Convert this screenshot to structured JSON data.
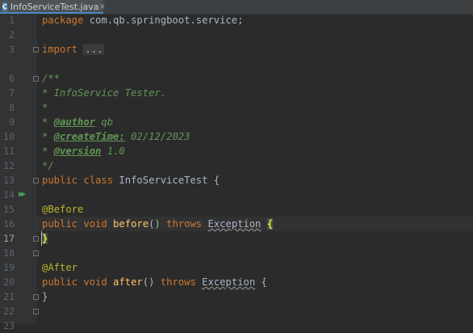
{
  "tab": {
    "title": "InfoServiceTest.java",
    "file_icon": "java-class-icon",
    "close_icon": "×"
  },
  "lines": {
    "n1": "1",
    "n2": "2",
    "n3": "3",
    "n6": "6",
    "n7": "7",
    "n8": "8",
    "n9": "9",
    "n10": "10",
    "n11": "11",
    "n12": "12",
    "n13": "13",
    "n14": "14",
    "n15": "15",
    "n16": "16",
    "n17": "17",
    "n18": "18",
    "n19": "19",
    "n20": "20",
    "n21": "21",
    "n22": "22",
    "n23": "23"
  },
  "code": {
    "l1_kw": "package",
    "l1_rest": " com.qb.springboot.service;",
    "l3_kw": "import",
    "l3_dots": "...",
    "l7": "/**",
    "l8": "* InfoService Tester.",
    "l9": "*",
    "l10_star": "* ",
    "l10_tag": "@author",
    "l10_val": " qb",
    "l11_star": "* ",
    "l11_tag": "@createTime:",
    "l11_val": " 02/12/2023",
    "l12_star": "* ",
    "l12_tag": "@version",
    "l12_val": " 1.0",
    "l13": "*/",
    "l14_kw": "public class",
    "l14_name": " InfoServiceTest {",
    "l16": "@Before",
    "l17_kw1": "public void",
    "l17_fn": " before",
    "l17_p": "() ",
    "l17_kw2": "throws",
    "l17_sp": " ",
    "l17_exc": "Exception",
    "l17_sp2": " ",
    "l17_brace": "{",
    "l18_brace": "}",
    "l20": "@After",
    "l21_kw1": "public void",
    "l21_fn": " after",
    "l21_p": "() ",
    "l21_kw2": "throws",
    "l21_sp": " ",
    "l21_exc": "Exception",
    "l21_rest": " {",
    "l22": "}"
  },
  "colors": {
    "background": "#2b2b2b",
    "keyword": "#cc7832",
    "doc": "#629755",
    "annotation": "#bbb529",
    "function": "#ffc66d",
    "run_icon": "#499c54"
  }
}
